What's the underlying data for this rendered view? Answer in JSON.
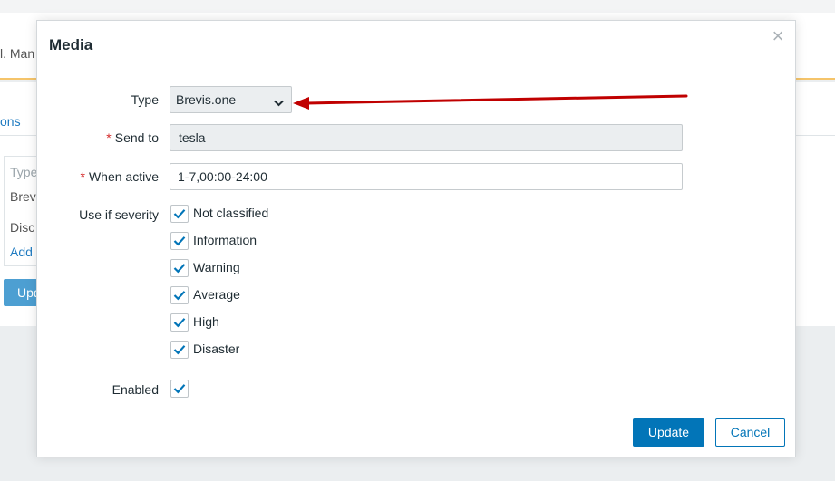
{
  "background": {
    "header_text": "l. Man",
    "tab_text": "ons",
    "table_rows": [
      "Type",
      "Brev",
      "Disc",
      "Add"
    ],
    "button_label": "Upd"
  },
  "dialog": {
    "title": "Media",
    "close_glyph": "×",
    "type_label": "Type",
    "type_value": "Brevis.one",
    "send_to_label": "Send to",
    "send_to_value": "tesla",
    "when_active_label": "When active",
    "when_active_value": "1-7,00:00-24:00",
    "severity_label": "Use if severity",
    "severities": [
      {
        "label": "Not classified",
        "checked": true
      },
      {
        "label": "Information",
        "checked": true
      },
      {
        "label": "Warning",
        "checked": true
      },
      {
        "label": "Average",
        "checked": true
      },
      {
        "label": "High",
        "checked": true
      },
      {
        "label": "Disaster",
        "checked": true
      }
    ],
    "enabled_label": "Enabled",
    "enabled_checked": true,
    "required_marker": "*",
    "update_label": "Update",
    "cancel_label": "Cancel"
  },
  "colors": {
    "primary": "#0275b8",
    "required": "#d42a2a",
    "annotation_arrow": "#c00000",
    "header_accent": "#f5c46a"
  },
  "icons": {
    "select_caret": "chevron-down-icon",
    "checkbox_mark": "checkmark-icon",
    "close": "close-icon",
    "annotation": "red-arrow-annotation"
  }
}
